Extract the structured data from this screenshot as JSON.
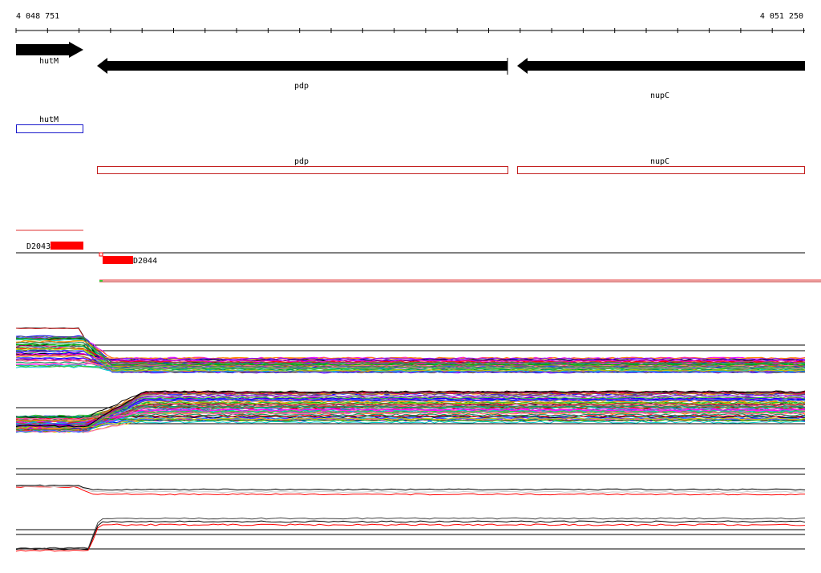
{
  "browser": {
    "coord_start": "4 048 751",
    "coord_end": "4 051 250",
    "genes": [
      {
        "name": "hutM",
        "strand": "+"
      },
      {
        "name": "pdp",
        "strand": "-"
      },
      {
        "name": "nupC",
        "strand": "-"
      }
    ],
    "operons": [
      {
        "name": "hutM",
        "color": "#1a1acc"
      },
      {
        "name": "pdp",
        "color": "#c42020"
      },
      {
        "name": "nupC",
        "color": "#c42020"
      }
    ],
    "features": [
      {
        "name": "D2043",
        "color": "#ff0000"
      },
      {
        "name": "D2044",
        "color": "#ff0000"
      }
    ],
    "colors": {
      "gene_arrow": "#000000",
      "feature": "#ff0000",
      "axis": "#000000"
    }
  }
}
